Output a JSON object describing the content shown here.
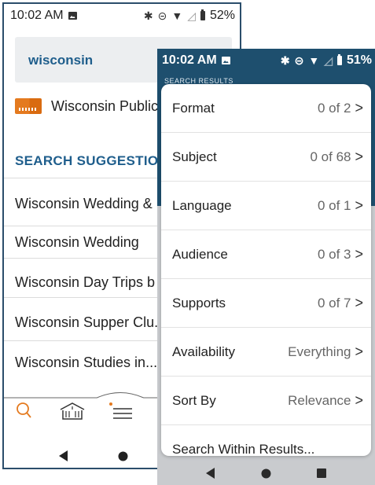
{
  "back": {
    "status": {
      "time": "10:02 AM",
      "battery": "52%"
    },
    "search": {
      "query": "wisconsin"
    },
    "library": {
      "name": "Wisconsin Public"
    },
    "suggestions": {
      "heading": "SEARCH SUGGESTIONS",
      "items": [
        "Wisconsin Wedding &",
        "Wisconsin Wedding",
        "Wisconsin Day Trips b",
        "Wisconsin Supper Clu...",
        "Wisconsin Studies in..."
      ]
    },
    "nav": {
      "icons": [
        "search-icon",
        "library-icon",
        "menu-icon"
      ]
    }
  },
  "front": {
    "status": {
      "time": "10:02 AM",
      "battery": "51%"
    },
    "results_label": "SEARCH RESULTS",
    "filters": [
      {
        "label": "Format",
        "value": "0 of 2"
      },
      {
        "label": "Subject",
        "value": "0 of 68"
      },
      {
        "label": "Language",
        "value": "0 of 1"
      },
      {
        "label": "Audience",
        "value": "0 of 3"
      },
      {
        "label": "Supports",
        "value": "0 of 7"
      },
      {
        "label": "Availability",
        "value": "Everything"
      },
      {
        "label": "Sort By",
        "value": "Relevance"
      },
      {
        "label": "Search Within Results...",
        "value": ""
      }
    ]
  },
  "colors": {
    "brand_blue": "#1e4f6e",
    "accent_orange": "#e47a1f"
  }
}
